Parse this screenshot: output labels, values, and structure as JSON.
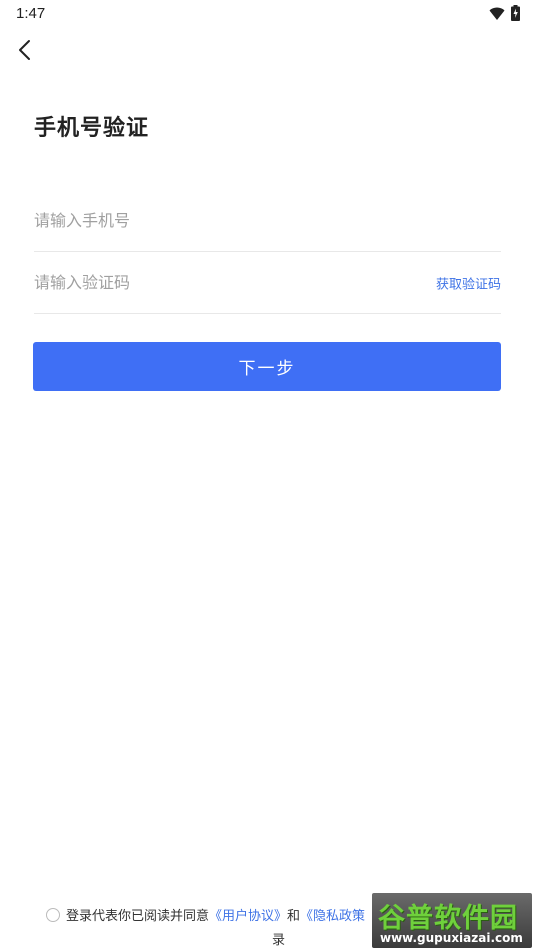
{
  "status_bar": {
    "time": "1:47",
    "icons": [
      "wifi-icon",
      "battery-charging-icon"
    ]
  },
  "header": {
    "back_icon": "chevron-left-icon"
  },
  "page": {
    "title": "手机号验证"
  },
  "form": {
    "phone_placeholder": "请输入手机号",
    "phone_value": "",
    "code_placeholder": "请输入验证码",
    "code_value": "",
    "get_code_label": "获取验证码",
    "next_label": "下一步"
  },
  "agreement": {
    "text_prefix": "登录代表你已阅读并同意",
    "user_agreement": "《用户协议》",
    "and": "和",
    "privacy_policy": "《隐私政策",
    "line2": "录"
  },
  "watermark": {
    "logo": "谷普软件园",
    "url": "www.gupuxiazai.com"
  },
  "colors": {
    "accent": "#3f6ff5",
    "link": "#3f73e6",
    "placeholder": "#a0a0a0",
    "divider": "#e8e8e8"
  }
}
